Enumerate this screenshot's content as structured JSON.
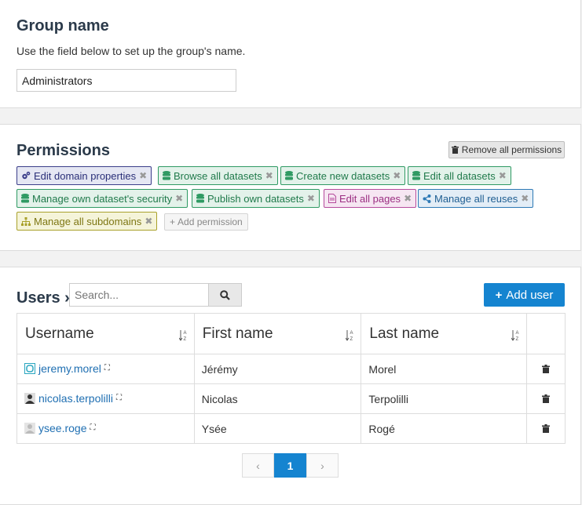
{
  "group": {
    "title": "Group name",
    "description": "Use the field below to set up the group's name.",
    "name_value": "Administrators"
  },
  "permissions": {
    "title": "Permissions",
    "remove_all_label": "Remove all permissions",
    "add_label": "Add permission",
    "tags": [
      {
        "label": "Edit domain properties",
        "icon": "cogs-icon"
      },
      {
        "label": "Browse all datasets",
        "icon": "database-icon"
      },
      {
        "label": "Create new datasets",
        "icon": "database-icon"
      },
      {
        "label": "Edit all datasets",
        "icon": "database-icon"
      },
      {
        "label": "Manage own dataset's security",
        "icon": "database-icon"
      },
      {
        "label": "Publish own datasets",
        "icon": "database-icon"
      },
      {
        "label": "Edit all pages",
        "icon": "file-icon"
      },
      {
        "label": "Manage all reuses",
        "icon": "share-icon"
      },
      {
        "label": "Manage all subdomains",
        "icon": "sitemap-icon"
      }
    ]
  },
  "users": {
    "title": "Users",
    "search_placeholder": "Search...",
    "add_label": "Add user",
    "columns": [
      "Username",
      "First name",
      "Last name"
    ],
    "rows": [
      {
        "username": "jeremy.morel",
        "first": "Jérémy",
        "last": "Morel"
      },
      {
        "username": "nicolas.terpolilli",
        "first": "Nicolas",
        "last": "Terpolilli"
      },
      {
        "username": "ysee.roge",
        "first": "Ysée",
        "last": "Rogé"
      }
    ]
  },
  "pagination": {
    "prev": "‹",
    "current": "1",
    "next": "›"
  },
  "colors": {
    "accent": "#1584d0"
  }
}
